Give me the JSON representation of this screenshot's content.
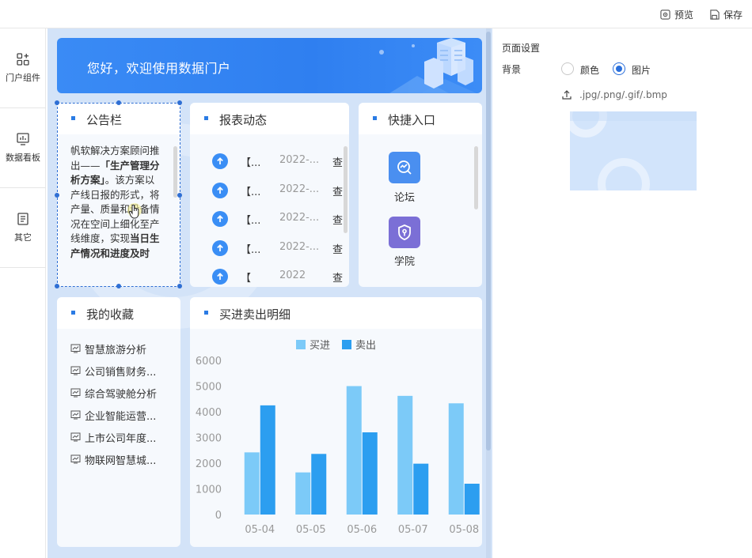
{
  "topbar": {
    "preview_label": "预览",
    "save_label": "保存"
  },
  "sidebar": {
    "items": [
      {
        "label": "门户组件",
        "icon": "component-grid-icon"
      },
      {
        "label": "数据看板",
        "icon": "dashboard-chart-icon"
      },
      {
        "label": "其它",
        "icon": "document-icon"
      }
    ]
  },
  "banner": {
    "text": "您好，欢迎使用数据门户"
  },
  "notice": {
    "title": "公告栏",
    "text_part1": "帆软解决方案顾问推出——",
    "text_bold1": "「生产管理分析方案」",
    "text_part2": "。该方案以产线日报的形式，将产量、质量和设备情况在空间上细化至产线维度，实现",
    "text_bold2": "当日生产情况和进度及时"
  },
  "reports": {
    "title": "报表动态",
    "items": [
      {
        "title": "【...",
        "date": "2022-...",
        "action": "查"
      },
      {
        "title": "【...",
        "date": "2022-...",
        "action": "查"
      },
      {
        "title": "【...",
        "date": "2022-...",
        "action": "查"
      },
      {
        "title": "【...",
        "date": "2022-...",
        "action": "查"
      },
      {
        "title": "【",
        "date": "2022",
        "action": "查"
      }
    ]
  },
  "quick": {
    "title": "快捷入口",
    "items": [
      {
        "label": "论坛",
        "icon": "forum-chart-icon",
        "color": "#4a8ff0"
      },
      {
        "label": "学院",
        "icon": "academy-shield-icon",
        "color": "#7b6fd6"
      }
    ]
  },
  "favorites": {
    "title": "我的收藏",
    "items": [
      {
        "label": "智慧旅游分析"
      },
      {
        "label": "公司销售财务..."
      },
      {
        "label": "综合驾驶舱分析"
      },
      {
        "label": "企业智能运营..."
      },
      {
        "label": "上市公司年度..."
      },
      {
        "label": "物联网智慧城..."
      }
    ]
  },
  "trade_chart_title": "买进卖出明细",
  "chart_data": {
    "type": "bar",
    "categories": [
      "05-04",
      "05-05",
      "05-06",
      "05-07",
      "05-08"
    ],
    "series": [
      {
        "name": "买进",
        "values": [
          2420,
          1640,
          5000,
          4620,
          4330
        ],
        "color": "#7ccaf8"
      },
      {
        "name": "卖出",
        "values": [
          4250,
          2360,
          3200,
          1980,
          1200
        ],
        "color": "#2c9ef0"
      }
    ],
    "yticks": [
      "0",
      "1000",
      "2000",
      "3000",
      "4000",
      "5000",
      "6000"
    ],
    "ylim": [
      0,
      6000
    ],
    "legend_position": "top-center",
    "grid": false
  },
  "panel": {
    "title": "页面设置",
    "bg_label": "背景",
    "option_color": "颜色",
    "option_image": "图片",
    "selected": "图片",
    "upload_hint": ".jpg/.png/.gif/.bmp"
  }
}
